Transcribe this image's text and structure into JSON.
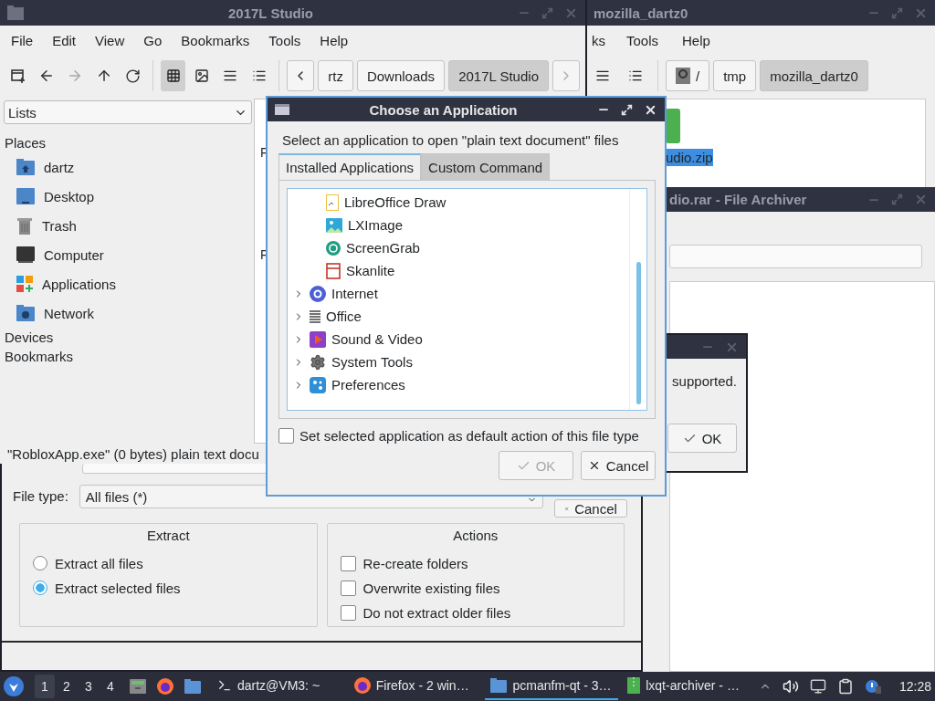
{
  "file_manager_right": {
    "title": "mozilla_dartz0",
    "menu": [
      "ks",
      "Tools",
      "Help"
    ],
    "path": [
      {
        "label": "/",
        "kind": "root",
        "selected": false
      },
      {
        "label": "tmp",
        "kind": "dir",
        "selected": false
      },
      {
        "label": "mozilla_dartz0",
        "kind": "dir",
        "selected": true
      }
    ],
    "file": {
      "name": "udio.zip",
      "selected": true
    }
  },
  "archiver": {
    "title": "dio.rar - File Archiver"
  },
  "message_box": {
    "text": "supported.",
    "button": "OK"
  },
  "extract_dialog": {
    "file_type_label": "File type:",
    "file_type": "All files (*)",
    "cancel": "Cancel",
    "extract": {
      "title": "Extract",
      "options": [
        {
          "label": "Extract all files",
          "selected": false
        },
        {
          "label": "Extract selected files",
          "selected": true
        }
      ]
    },
    "actions": {
      "title": "Actions",
      "options": [
        {
          "label": "Re-create folders",
          "checked": false
        },
        {
          "label": "Overwrite existing files",
          "checked": false
        },
        {
          "label": "Do not extract older files",
          "checked": false
        }
      ]
    }
  },
  "file_manager": {
    "title": "2017L Studio",
    "menu": [
      "File",
      "Edit",
      "View",
      "Go",
      "Bookmarks",
      "Tools",
      "Help"
    ],
    "nav": [
      {
        "kind": "new-tab",
        "disabled": false
      },
      {
        "kind": "back",
        "disabled": false
      },
      {
        "kind": "forward",
        "disabled": true
      },
      {
        "kind": "up",
        "disabled": false
      },
      {
        "kind": "reload",
        "disabled": false
      }
    ],
    "view_modes": [
      {
        "kind": "icons",
        "selected": true
      },
      {
        "kind": "thumbnails",
        "selected": false
      },
      {
        "kind": "compact",
        "selected": false
      },
      {
        "kind": "details",
        "selected": false
      }
    ],
    "path": [
      {
        "label": "rtz",
        "selected": false
      },
      {
        "label": "Downloads",
        "selected": false
      },
      {
        "label": "2017L Studio",
        "selected": true
      }
    ],
    "sidebar": {
      "combo": "Lists",
      "sections": [
        {
          "title": "Places",
          "items": [
            {
              "label": "dartz",
              "kind": "home"
            },
            {
              "label": "Desktop",
              "kind": "desktop"
            },
            {
              "label": "Trash",
              "kind": "trash"
            },
            {
              "label": "Computer",
              "kind": "computer"
            },
            {
              "label": "Applications",
              "kind": "apps"
            },
            {
              "label": "Network",
              "kind": "network"
            }
          ]
        },
        {
          "title": "Devices"
        },
        {
          "title": "Bookmarks"
        }
      ]
    },
    "files": [
      "F",
      "F"
    ],
    "status": "\"RobloxApp.exe\" (0 bytes) plain text docu"
  },
  "dialog": {
    "title": "Choose an Application",
    "prompt": "Select an application to open \"plain text document\" files",
    "tabs": [
      {
        "label": "Installed Applications",
        "selected": true
      },
      {
        "label": "Custom Command",
        "selected": false
      }
    ],
    "tree": [
      {
        "children": [
          {
            "label": "LibreOffice Draw",
            "kind": "draw"
          },
          {
            "label": "LXImage",
            "kind": "image"
          },
          {
            "label": "ScreenGrab",
            "kind": "grab"
          },
          {
            "label": "Skanlite",
            "kind": "scan"
          }
        ]
      },
      {
        "label": "Internet",
        "kind": "internet",
        "expanded": false
      },
      {
        "label": "Office",
        "kind": "office",
        "expanded": false
      },
      {
        "label": "Sound & Video",
        "kind": "media",
        "expanded": false
      },
      {
        "label": "System Tools",
        "kind": "system",
        "expanded": false
      },
      {
        "label": "Preferences",
        "kind": "prefs",
        "expanded": false
      }
    ],
    "default_checkbox": {
      "label": "Set selected application as default action of this file type",
      "checked": false
    },
    "buttons": [
      {
        "label": "OK",
        "kind": "ok",
        "disabled": true
      },
      {
        "label": "Cancel",
        "kind": "cancel",
        "disabled": false
      }
    ]
  },
  "taskbar": {
    "workspaces": [
      {
        "label": "1",
        "selected": true
      },
      {
        "label": "2",
        "selected": false
      },
      {
        "label": "3",
        "selected": false
      },
      {
        "label": "4",
        "selected": false
      }
    ],
    "launchers": [
      {
        "kind": "files"
      },
      {
        "kind": "firefox"
      },
      {
        "kind": "folder"
      }
    ],
    "tasks": [
      {
        "label": "dartz@VM3: ~",
        "kind": "terminal",
        "selected": false
      },
      {
        "label": "Firefox - 2 win…",
        "kind": "firefox",
        "selected": false
      },
      {
        "label": "pcmanfm-qt - 3…",
        "kind": "folder",
        "selected": true
      },
      {
        "label": "lxqt-archiver - …",
        "kind": "archive",
        "selected": false
      }
    ],
    "clock": "12:28"
  }
}
